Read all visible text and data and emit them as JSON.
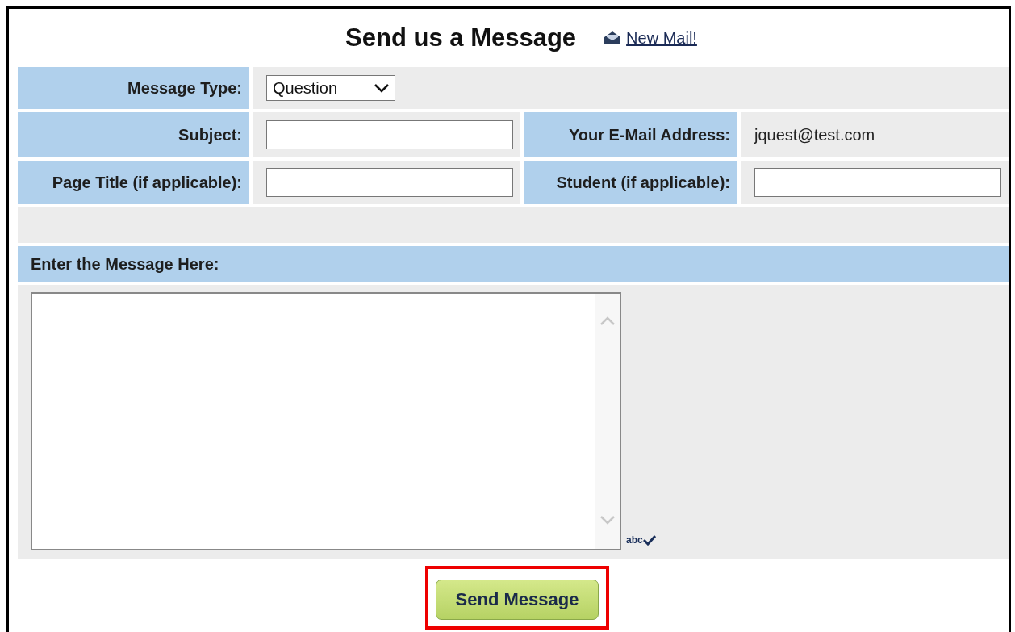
{
  "header": {
    "title": "Send us a Message",
    "link": "New Mail!"
  },
  "form": {
    "message_type": {
      "label": "Message Type:",
      "value": "Question"
    },
    "subject": {
      "label": "Subject:"
    },
    "email": {
      "label": "Your E-Mail Address:",
      "value": "jquest@test.com"
    },
    "page_title": {
      "label": "Page Title (if applicable):"
    },
    "student": {
      "label": "Student (if applicable):"
    },
    "message": {
      "label": "Enter the Message Here:"
    },
    "spellcheck": "abc"
  },
  "submit": {
    "label": "Send Message",
    "highlighted": true
  }
}
